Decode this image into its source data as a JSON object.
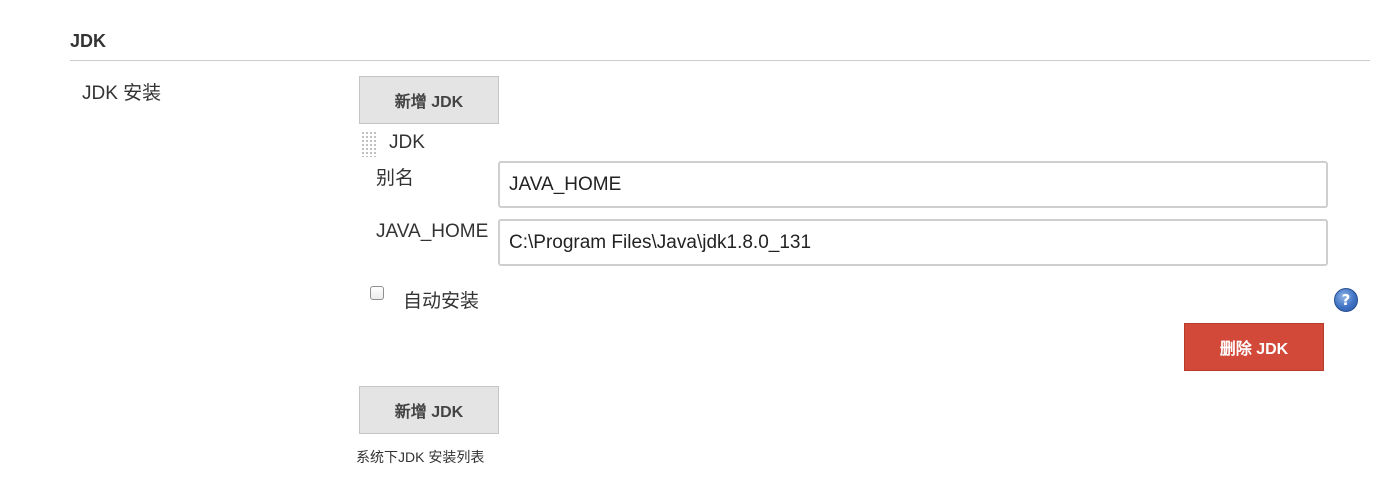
{
  "section": {
    "title": "JDK"
  },
  "jdk_row": {
    "label": "JDK 安装",
    "add_button_top": "新增 JDK",
    "add_button_bottom": "新增 JDK",
    "description": "系统下JDK 安装列表"
  },
  "jdk_entry": {
    "heading": "JDK",
    "alias_label": "别名",
    "alias_value": "JAVA_HOME",
    "home_label": "JAVA_HOME",
    "home_value": "C:\\Program Files\\Java\\jdk1.8.0_131",
    "auto_install_label": "自动安装",
    "auto_install_checked": false,
    "help_glyph": "?",
    "delete_button": "删除 JDK"
  },
  "colors": {
    "delete_button": "#d24939",
    "gray_button": "#e4e4e4",
    "help_icon": "#3f72c4"
  }
}
